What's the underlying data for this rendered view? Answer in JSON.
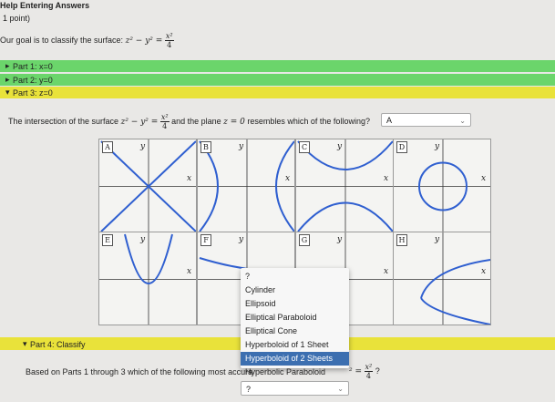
{
  "page": {
    "title": "Help Entering Answers",
    "points": "1 point)",
    "goal_text": "Our goal is to classify the surface:",
    "parts": [
      {
        "label": "Part 1: x=0",
        "color": "#6bd56b",
        "state": "collapsed"
      },
      {
        "label": "Part 2: y=0",
        "color": "#6bd56b",
        "state": "collapsed"
      },
      {
        "label": "Part 3: z=0",
        "color": "#e9e23a",
        "state": "expanded"
      },
      {
        "label": "Part 4: Classify",
        "color": "#e9e23a",
        "state": "expanded"
      }
    ],
    "question": {
      "prefix": "The intersection of the surface",
      "mid": "and the plane",
      "plane": "z = 0",
      "suffix": "resembles which of the following?",
      "selected": "A"
    },
    "graphs": [
      "A",
      "B",
      "C",
      "D",
      "E",
      "F",
      "G",
      "H"
    ],
    "axis_x": "x",
    "axis_y": "y",
    "part4_question": "Based on Parts 1 through 3 which of the following most accura",
    "part4_selected": "?",
    "dropdown_options": [
      "?",
      "Cylinder",
      "Ellipsoid",
      "Elliptical Paraboloid",
      "Elliptical Cone",
      "Hyperboloid of 1 Sheet",
      "Hyperboloid of 2 Sheets",
      "Hyperbolic Paraboloid"
    ],
    "dropdown_highlighted": "Hyperboloid of 2 Sheets",
    "colors": {
      "curve": "#2f5fd0",
      "green_bar": "#6bd56b",
      "yellow_bar": "#e9e23a"
    }
  },
  "equation": {
    "lhs": "z² − y² =",
    "num": "x²",
    "den": "4"
  },
  "equation_q": {
    "lhs": "z² − y² =",
    "num": "x²",
    "den": "4"
  },
  "equation_p4": {
    "num": "x²",
    "den": "4",
    "tail": "?"
  }
}
